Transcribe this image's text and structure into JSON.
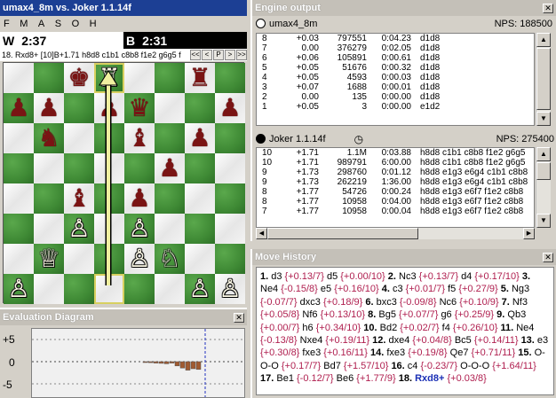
{
  "window": {
    "title": "umax4_8m vs. Joker 1.1.14f"
  },
  "menu": [
    "F",
    "M",
    "A",
    "S",
    "O",
    "H"
  ],
  "clocks": {
    "white_label": "W",
    "white_time": "2:37",
    "black_label": "B",
    "black_time": "2:31"
  },
  "pv_bar": {
    "text": "18. Rxd8+ [10]B+1.71 h8d8 c1b1 c8b8 f1e2 g6g5 f",
    "nav": [
      "<<",
      "<",
      "P",
      ">",
      ">>"
    ]
  },
  "board": {
    "ranks": [
      [
        "",
        "",
        "bK",
        "wR",
        "",
        "",
        "bR",
        ""
      ],
      [
        "bP",
        "bP",
        "",
        "bP",
        "bQ",
        "",
        "",
        "bP"
      ],
      [
        "",
        "bN",
        "",
        "",
        "bB",
        "",
        "bP",
        ""
      ],
      [
        "",
        "",
        "",
        "",
        "",
        "bP",
        "",
        ""
      ],
      [
        "",
        "",
        "bB",
        "",
        "bP",
        "",
        "",
        ""
      ],
      [
        "",
        "",
        "wP",
        "",
        "wP",
        "",
        "",
        ""
      ],
      [
        "",
        "wQ",
        "",
        "",
        "wP",
        "wN",
        "",
        ""
      ],
      [
        "wP",
        "",
        "",
        "",
        "",
        "",
        "wP",
        "wP"
      ]
    ],
    "bottom_rank": [
      "",
      "",
      "wK",
      "",
      "wB",
      "wB",
      "",
      "wR"
    ],
    "last_move": "Rxd8+",
    "colors": {
      "light": "#f4f4f4",
      "dark": "#3f8a35",
      "black_piece": "#7a1414"
    }
  },
  "engine_output": {
    "title": "Engine output",
    "engine1": {
      "name": "umax4_8m",
      "nps": "NPS: 188500",
      "rows": [
        [
          "8",
          "+0.03",
          "797551",
          "0:04.23",
          "d1d8"
        ],
        [
          "7",
          "0.00",
          "376279",
          "0:02.05",
          "d1d8"
        ],
        [
          "6",
          "+0.06",
          "105891",
          "0:00.61",
          "d1d8"
        ],
        [
          "5",
          "+0.05",
          "51676",
          "0:00.32",
          "d1d8"
        ],
        [
          "4",
          "+0.05",
          "4593",
          "0:00.03",
          "d1d8"
        ],
        [
          "3",
          "+0.07",
          "1688",
          "0:00.01",
          "d1d8"
        ],
        [
          "2",
          "0.00",
          "135",
          "0:00.00",
          "d1d8"
        ],
        [
          "1",
          "+0.05",
          "3",
          "0:00.00",
          "e1d2"
        ]
      ]
    },
    "engine2": {
      "name": "Joker 1.1.14f",
      "nps": "NPS: 275400",
      "rows": [
        [
          "10",
          "+1.71",
          "1.1M",
          "0:03.88",
          "h8d8 c1b1 c8b8 f1e2 g6g5"
        ],
        [
          "10",
          "+1.71",
          "989791",
          "6:00.00",
          "h8d8 c1b1 c8b8 f1e2 g6g5"
        ],
        [
          "9",
          "+1.73",
          "298760",
          "0:01.12",
          "h8d8 e1g3 e6g4 c1b1 c8b8"
        ],
        [
          "9",
          "+1.73",
          "262219",
          "1:36.00",
          "h8d8 e1g3 e6g4 c1b1 c8b8"
        ],
        [
          "8",
          "+1.77",
          "54726",
          "0:00.24",
          "h8d8 e1g3 e6f7 f1e2 c8b8"
        ],
        [
          "8",
          "+1.77",
          "10958",
          "0:04.00",
          "h8d8 e1g3 e6f7 f1e2 c8b8"
        ],
        [
          "7",
          "+1.77",
          "10958",
          "0:00.04",
          "h8d8 e1g3 e6f7 f1e2 c8b8"
        ]
      ]
    }
  },
  "eval_diagram": {
    "title": "Evaluation Diagram",
    "labels": [
      "+5",
      "0",
      "-5"
    ],
    "bars": [
      -0.05,
      -0.07,
      -0.1,
      -0.12,
      -0.15,
      -0.1,
      -0.3,
      -0.45,
      -0.6,
      -0.5,
      -0.55
    ],
    "bar_color": "#a05a30"
  },
  "move_history": {
    "title": "Move History",
    "moves": [
      {
        "n": "1.",
        "w": "d3",
        "we": "{+0.13/7}",
        "b": "d5",
        "be": "{+0.00/10}"
      },
      {
        "n": "2.",
        "w": "Nc3",
        "we": "{+0.13/7}",
        "b": "d4",
        "be": "{+0.17/10}"
      },
      {
        "n": "3.",
        "w": "Ne4",
        "we": "{-0.15/8}",
        "b": "e5",
        "be": "{+0.16/10}"
      },
      {
        "n": "4.",
        "w": "c3",
        "we": "{+0.01/7}",
        "b": "f5",
        "be": "{+0.27/9}"
      },
      {
        "n": "5.",
        "w": "Ng3",
        "we": "{-0.07/7}",
        "b": "dxc3",
        "be": "{+0.18/9}"
      },
      {
        "n": "6.",
        "w": "bxc3",
        "we": "{-0.09/8}",
        "b": "Nc6",
        "be": "{+0.10/9}"
      },
      {
        "n": "7.",
        "w": "Nf3",
        "we": "{+0.05/8}",
        "b": "Nf6",
        "be": "{+0.13/10}"
      },
      {
        "n": "8.",
        "w": "Bg5",
        "we": "{+0.07/7}",
        "b": "g6",
        "be": "{+0.25/9}"
      },
      {
        "n": "9.",
        "w": "Qb3",
        "we": "{+0.00/7}",
        "b": "h6",
        "be": "{+0.34/10}"
      },
      {
        "n": "10.",
        "w": "Bd2",
        "we": "{+0.02/7}",
        "b": "f4",
        "be": "{+0.26/10}"
      },
      {
        "n": "11.",
        "w": "Ne4",
        "we": "{-0.13/8}",
        "b": "Nxe4",
        "be": "{+0.19/11}"
      },
      {
        "n": "12.",
        "w": "dxe4",
        "we": "{+0.04/8}",
        "b": "Bc5",
        "be": "{+0.14/11}"
      },
      {
        "n": "13.",
        "w": "e3",
        "we": "{+0.30/8}",
        "b": "fxe3",
        "be": "{+0.16/11}"
      },
      {
        "n": "14.",
        "w": "fxe3",
        "we": "{+0.19/8}",
        "b": "Qe7",
        "be": "{+0.71/11}"
      },
      {
        "n": "15.",
        "w": "O-O-O",
        "we": "{+0.17/7}",
        "b": "Bd7",
        "be": "{+1.57/10}"
      },
      {
        "n": "16.",
        "w": "c4",
        "we": "{-0.23/7}",
        "b": "O-O-O",
        "be": "{+1.64/11}"
      },
      {
        "n": "17.",
        "w": "Be1",
        "we": "{-0.12/7}",
        "b": "Be6",
        "be": "{+1.77/9}"
      },
      {
        "n": "18.",
        "w": "Rxd8+",
        "we": "{+0.03/8}",
        "b": "",
        "be": ""
      }
    ]
  }
}
